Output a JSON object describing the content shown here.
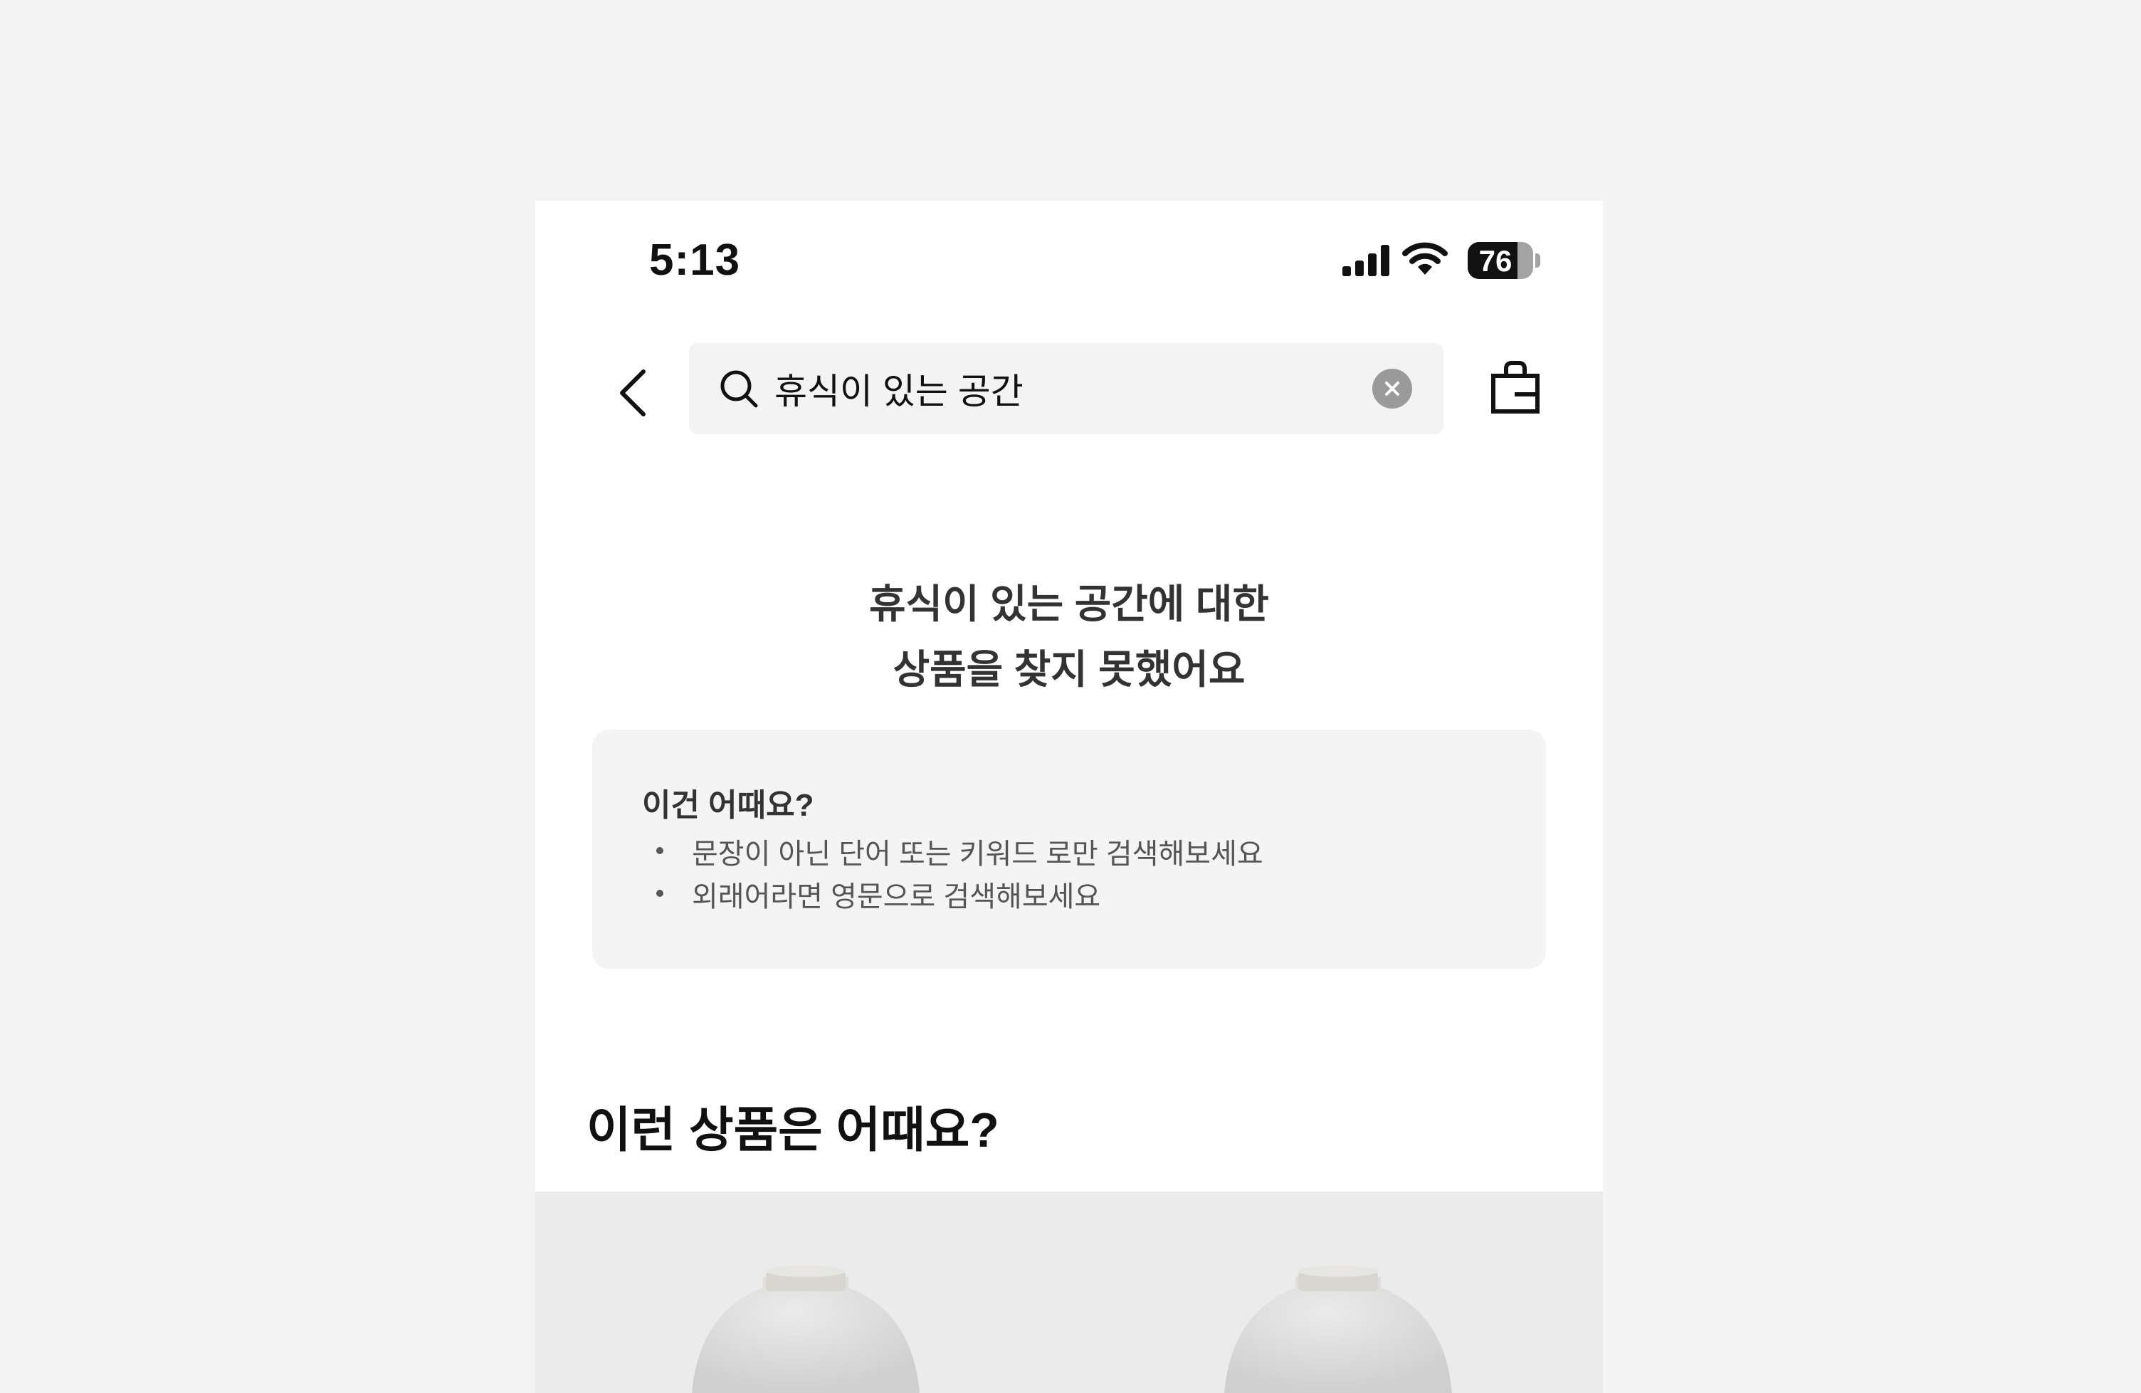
{
  "status_bar": {
    "time": "5:13",
    "battery_level": "76",
    "icons": [
      "cellular-signal-icon",
      "wifi-icon",
      "battery-icon"
    ]
  },
  "header": {
    "back_icon": "chevron-left-icon",
    "search": {
      "icon": "search-icon",
      "value": "휴식이 있는 공간",
      "clear_icon": "clear-icon"
    },
    "bag_icon": "shopping-bag-icon"
  },
  "empty_state": {
    "line1": "휴식이 있는 공간에 대한",
    "line2": "상품을 찾지 못했어요"
  },
  "tips": {
    "title": "이건 어때요?",
    "items": [
      "문장이 아닌 단어 또는 키워드 로만 검색해보세요",
      "외래어라면 영문으로 검색해보세요"
    ]
  },
  "recommendations": {
    "title": "이런 상품은 어때요?",
    "products": [
      "product-1",
      "product-2"
    ]
  },
  "colors": {
    "background": "#f4f4f4",
    "surface": "#ffffff",
    "search_bg": "#f3f3f3",
    "card_bg": "#f4f4f4",
    "text_primary": "#111111",
    "text_secondary": "#555555",
    "product_bg": "#ebebeb"
  }
}
